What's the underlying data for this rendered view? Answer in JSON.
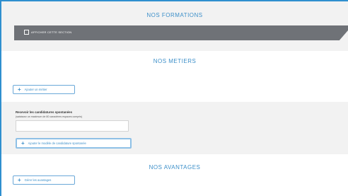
{
  "colors": {
    "accent": "#3c8fc9",
    "frame": "#2f8fcf",
    "dark_bar": "#6f7277",
    "band_gray": "#f2f2f2"
  },
  "formations": {
    "title": "NOS FORMATIONS",
    "checkbox_label": "Afficher cette section",
    "checked": false
  },
  "metiers": {
    "title": "NOS METIERS",
    "add_button": "Ajouter un métier",
    "add_icon": "plus-icon"
  },
  "candidatures": {
    "title": "Recevoir les candidatures spontanées",
    "hint": "(saisissez un maximum de 80 caractères espaces compris)",
    "input_value": "",
    "add_button": "Ajouter le modèle de candidature spontanée",
    "add_icon": "plus-icon"
  },
  "avantages": {
    "title": "NOS AVANTAGES",
    "add_button": "Gérer les avantages",
    "add_icon": "plus-icon"
  }
}
